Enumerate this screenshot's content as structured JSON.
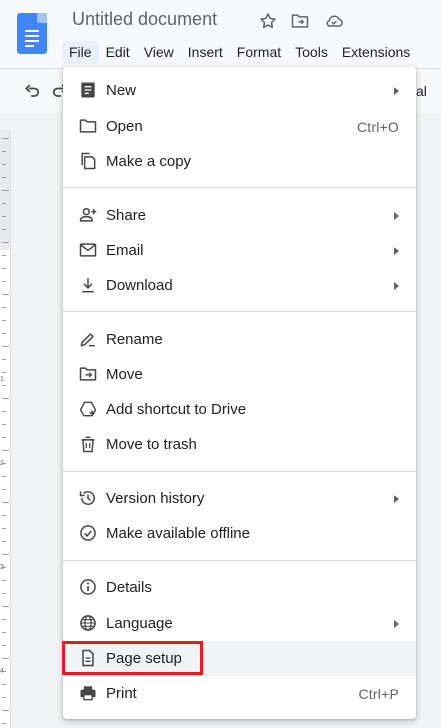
{
  "header": {
    "title": "Untitled document",
    "icons": [
      "star-icon",
      "move-folder-icon",
      "cloud-saved-icon"
    ]
  },
  "menubar": {
    "items": [
      "File",
      "Edit",
      "View",
      "Insert",
      "Format",
      "Tools",
      "Extensions"
    ],
    "active": "File"
  },
  "toolbar": {
    "icons": [
      "undo-icon",
      "redo-icon"
    ],
    "partial_text": "al"
  },
  "ruler": {
    "numbers": [
      "1",
      "2",
      "3",
      "4"
    ]
  },
  "file_menu": {
    "items": [
      {
        "label": "New",
        "icon": "new-doc-icon",
        "submenu": true,
        "shortcut": ""
      },
      {
        "label": "Open",
        "icon": "folder-icon",
        "submenu": false,
        "shortcut": "Ctrl+O"
      },
      {
        "label": "Make a copy",
        "icon": "copy-icon",
        "submenu": false,
        "shortcut": ""
      },
      {
        "label": "Share",
        "icon": "person-add-icon",
        "submenu": true,
        "shortcut": ""
      },
      {
        "label": "Email",
        "icon": "mail-icon",
        "submenu": true,
        "shortcut": ""
      },
      {
        "label": "Download",
        "icon": "download-icon",
        "submenu": true,
        "shortcut": ""
      },
      {
        "label": "Rename",
        "icon": "pencil-icon",
        "submenu": false,
        "shortcut": ""
      },
      {
        "label": "Move",
        "icon": "move-folder-icon",
        "submenu": false,
        "shortcut": ""
      },
      {
        "label": "Add shortcut to Drive",
        "icon": "drive-shortcut-icon",
        "submenu": false,
        "shortcut": ""
      },
      {
        "label": "Move to trash",
        "icon": "trash-icon",
        "submenu": false,
        "shortcut": ""
      },
      {
        "label": "Version history",
        "icon": "history-icon",
        "submenu": true,
        "shortcut": ""
      },
      {
        "label": "Make available offline",
        "icon": "offline-check-icon",
        "submenu": false,
        "shortcut": ""
      },
      {
        "label": "Details",
        "icon": "info-icon",
        "submenu": false,
        "shortcut": ""
      },
      {
        "label": "Language",
        "icon": "globe-icon",
        "submenu": true,
        "shortcut": ""
      },
      {
        "label": "Page setup",
        "icon": "page-icon",
        "submenu": false,
        "shortcut": ""
      },
      {
        "label": "Print",
        "icon": "printer-icon",
        "submenu": false,
        "shortcut": "Ctrl+P"
      }
    ],
    "hovered": "Page setup",
    "highlighted": "Page setup"
  },
  "colors": {
    "brand_blue": "#4285f4",
    "highlight_red": "#e02020",
    "menu_hover": "#f1f3f4",
    "active_menu_bg": "#e8f0fe"
  }
}
